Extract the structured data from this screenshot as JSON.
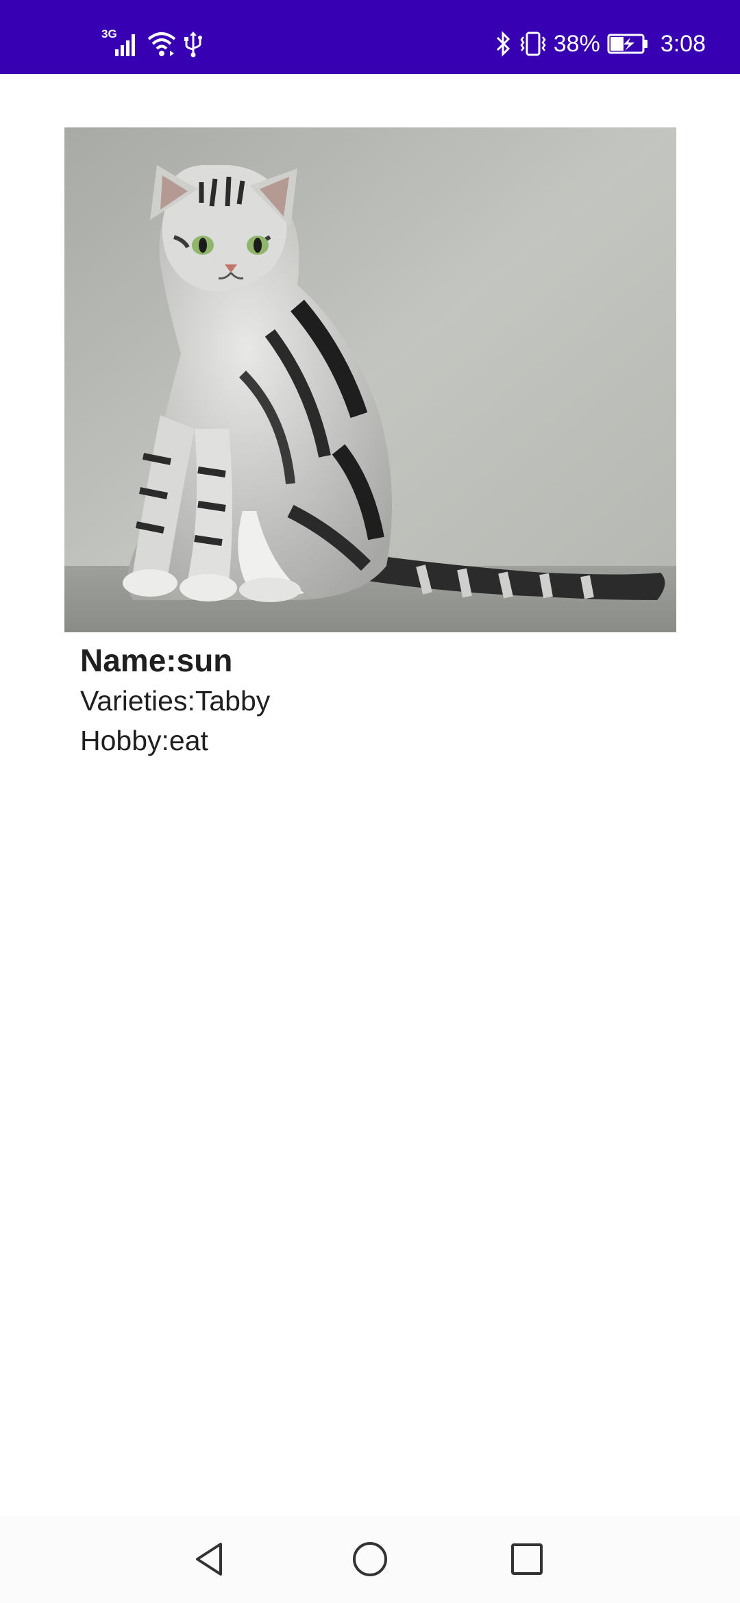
{
  "status_bar": {
    "network_type": "3G",
    "battery_percent": "38%",
    "time": "3:08",
    "background_color": "#3700b3",
    "icons_left": [
      "signal-icon",
      "wifi-icon",
      "usb-icon"
    ],
    "icons_right": [
      "bluetooth-icon",
      "vibrate-icon",
      "battery-charging-icon"
    ]
  },
  "cat": {
    "name": "Name:sun",
    "varieties": "Varieties:Tabby",
    "hobby": "Hobby:eat",
    "image_alt": "cat"
  },
  "nav_bar": {
    "buttons": [
      "back-icon",
      "home-icon",
      "recents-icon"
    ]
  }
}
